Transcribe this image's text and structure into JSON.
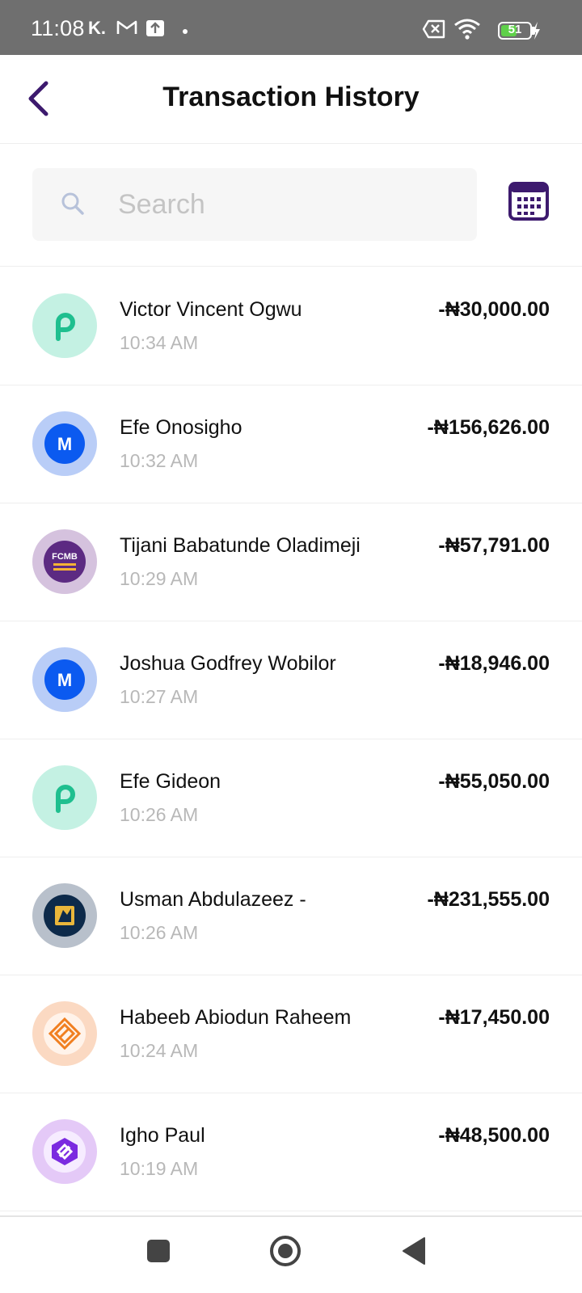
{
  "status_bar": {
    "time": "11:08",
    "carrier": "K.",
    "battery": "51",
    "icons": [
      "gmail-icon",
      "upload-icon",
      "no-sim-icon",
      "wifi-icon",
      "battery-icon",
      "charging-icon"
    ]
  },
  "header": {
    "title": "Transaction History",
    "back_icon": "chevron-left-icon",
    "accent": "#3d1a6e"
  },
  "search": {
    "placeholder": "Search",
    "value": "",
    "calendar_icon": "calendar-icon"
  },
  "transactions": [
    {
      "name": "Victor Vincent Ogwu",
      "time": "10:34 AM",
      "amount": "-₦30,000.00",
      "bank": "palmpay",
      "logo_text": "P"
    },
    {
      "name": "Efe Onosigho",
      "time": "10:32 AM",
      "amount": "-₦156,626.00",
      "bank": "moniepoint",
      "logo_text": "M"
    },
    {
      "name": "Tijani Babatunde Oladimeji",
      "time": "10:29 AM",
      "amount": "-₦57,791.00",
      "bank": "fcmb",
      "logo_text": "FCMB"
    },
    {
      "name": "Joshua Godfrey Wobilor",
      "time": "10:27 AM",
      "amount": "-₦18,946.00",
      "bank": "moniepoint",
      "logo_text": "M"
    },
    {
      "name": "Efe Gideon",
      "time": "10:26 AM",
      "amount": "-₦55,050.00",
      "bank": "palmpay",
      "logo_text": "P"
    },
    {
      "name": "Usman Abdulazeez -",
      "time": "10:26 AM",
      "amount": "-₦231,555.00",
      "bank": "first-bank",
      "logo_text": ""
    },
    {
      "name": "Habeeb Abiodun Raheem",
      "time": "10:24 AM",
      "amount": "-₦17,450.00",
      "bank": "access",
      "logo_text": ""
    },
    {
      "name": "Igho Paul",
      "time": "10:19 AM",
      "amount": "-₦48,500.00",
      "bank": "kuda",
      "logo_text": ""
    }
  ],
  "nav_bar": {
    "buttons": [
      "recents-button",
      "home-button",
      "back-button"
    ]
  }
}
